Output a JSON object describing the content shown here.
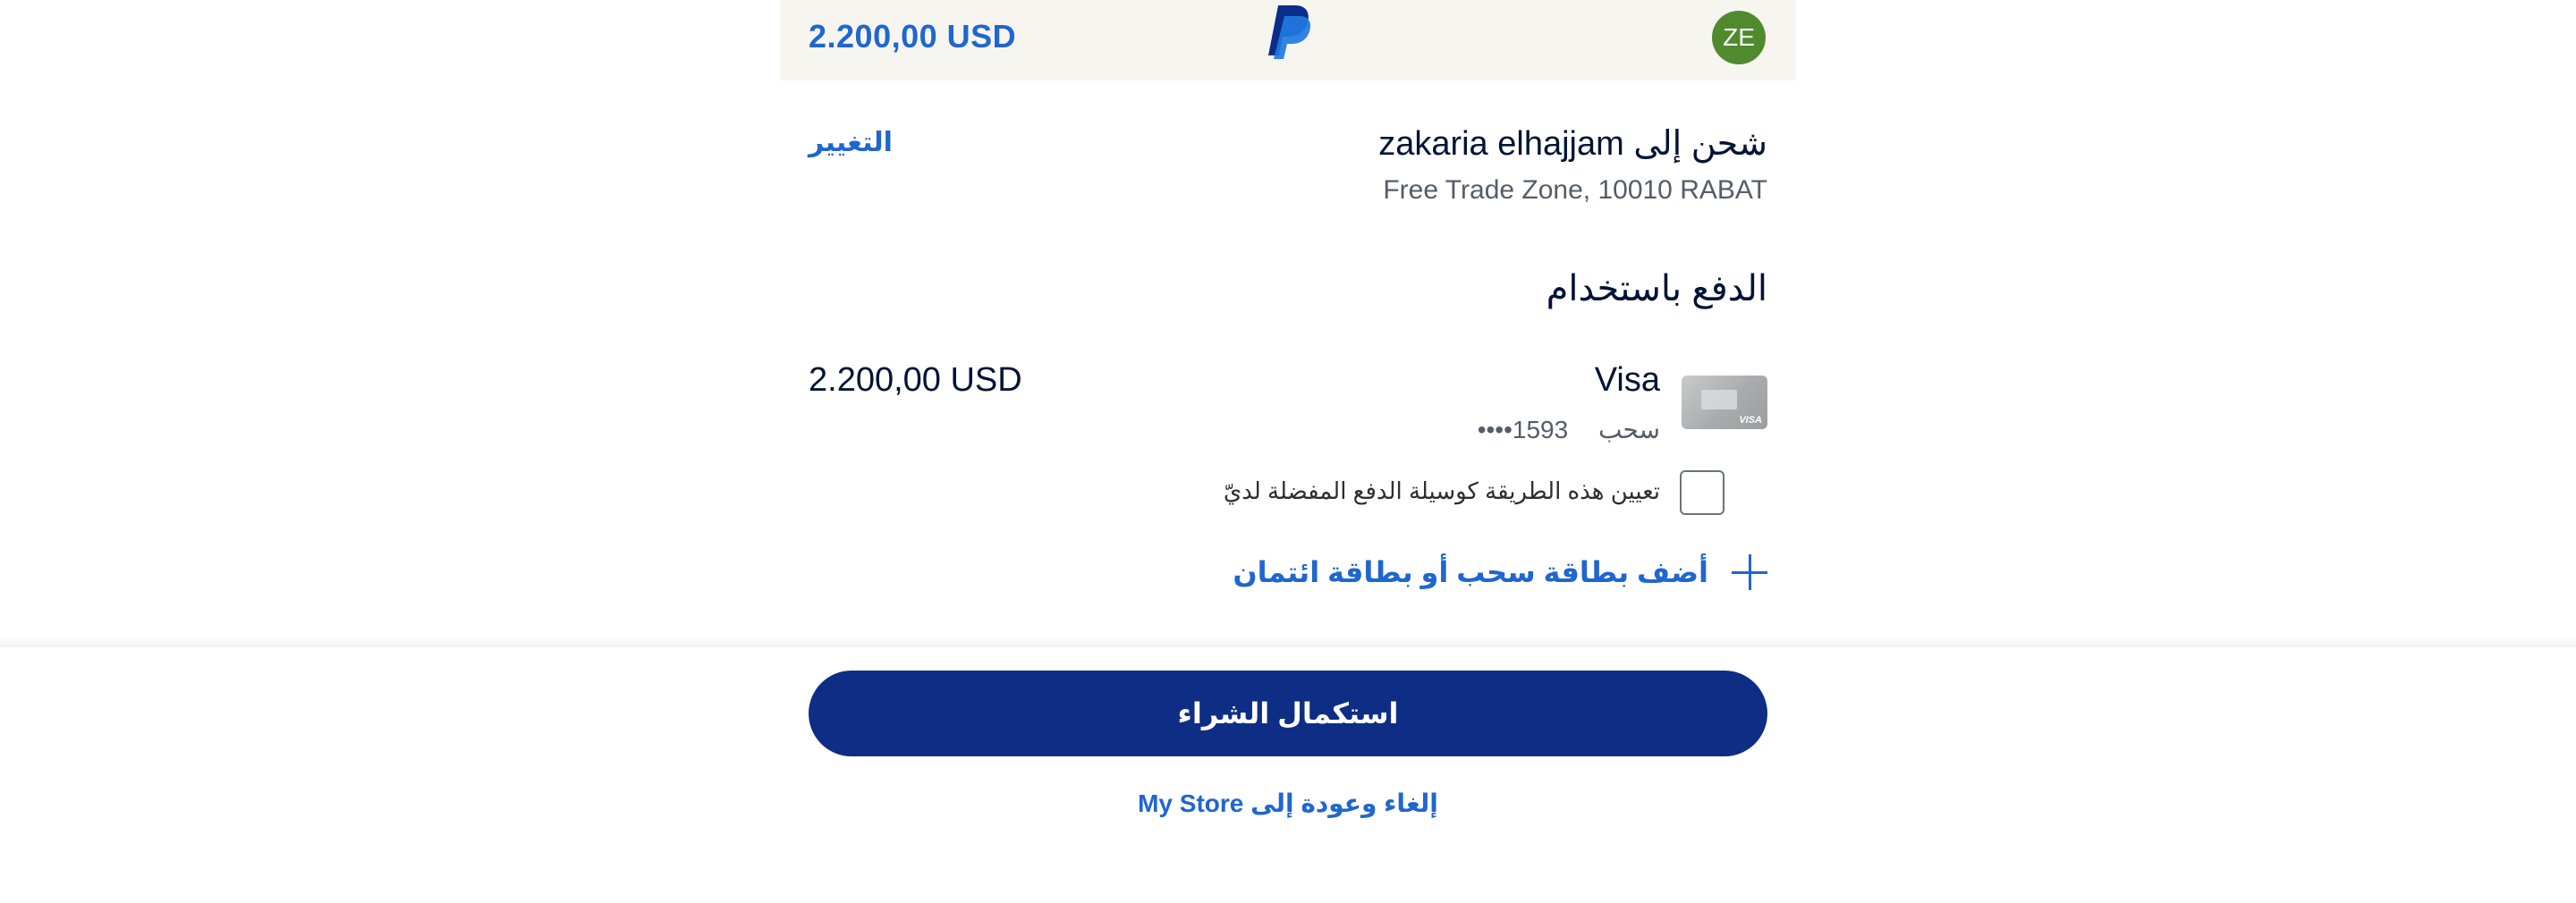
{
  "header": {
    "amount": "2.200,00 USD",
    "logo_icon": "paypal-logo-icon",
    "avatar_initials": "ZE",
    "avatar_color": "#4f8b2c"
  },
  "shipping": {
    "title": "شحن إلى zakaria elhajjam",
    "address": "Free Trade Zone, 10010 RABAT",
    "change_label": "التغيير"
  },
  "payment": {
    "title": "الدفع باستخدام",
    "card": {
      "icon": "visa-card-icon",
      "name": "Visa",
      "type": "سحب",
      "masked_number": "••••1593",
      "amount": "2.200,00 USD"
    },
    "preferred_label": "تعيين هذه الطريقة كوسيلة الدفع المفضلة لديّ",
    "preferred_checked": false,
    "add_card_label": "أضف بطاقة سحب أو بطاقة ائتمان"
  },
  "footer": {
    "complete_label": "استكمال الشراء",
    "cancel_label": "إلغاء وعودة إلى My Store"
  },
  "colors": {
    "accent": "#1f66d0",
    "button": "#0e2e85",
    "header_bg": "#f7f5f0"
  }
}
